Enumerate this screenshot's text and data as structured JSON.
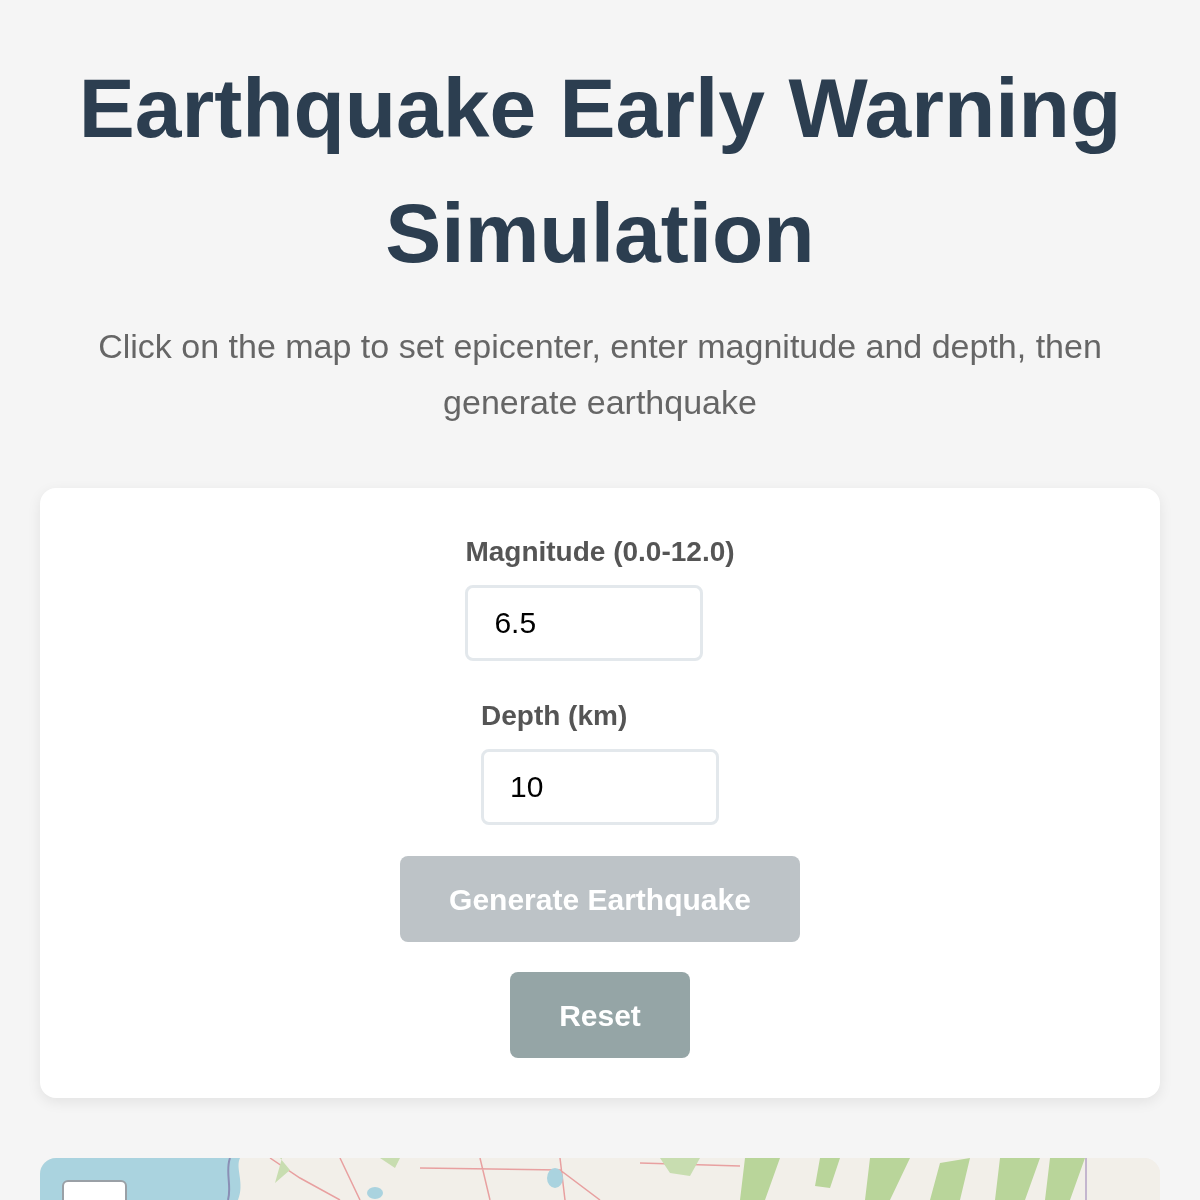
{
  "title": "Earthquake Early Warning Simulation",
  "subtitle": "Click on the map to set epicenter, enter magnitude and depth, then generate earthquake",
  "fields": [
    {
      "label": "Magnitude (0.0-12.0)",
      "value": "6.5"
    },
    {
      "label": "Depth (km)",
      "value": "10"
    }
  ],
  "buttons": [
    {
      "label": "Generate Earthquake",
      "kind": "primary",
      "disabled": true
    },
    {
      "label": "Reset",
      "kind": "secondary",
      "disabled": false
    }
  ]
}
